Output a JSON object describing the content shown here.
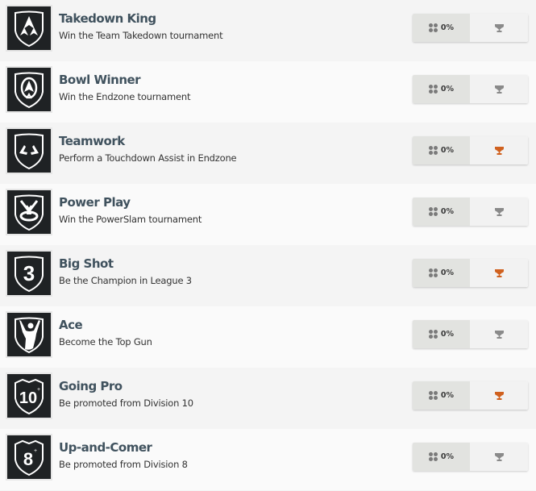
{
  "colors": {
    "trophy_earned": "#d0611f",
    "trophy_unearned": "#8a8a8a",
    "title": "#40525e"
  },
  "achievements": [
    {
      "title": "Takedown King",
      "description": "Win the Team Takedown tournament",
      "icon": "triple-arrow-shield-icon",
      "progress": "0%",
      "trophy": "unearned"
    },
    {
      "title": "Bowl Winner",
      "description": "Win the Endzone tournament",
      "icon": "bowl-arrow-shield-icon",
      "progress": "0%",
      "trophy": "unearned"
    },
    {
      "title": "Teamwork",
      "description": "Perform a Touchdown Assist in Endzone",
      "icon": "horns-shield-icon",
      "progress": "0%",
      "trophy": "earned"
    },
    {
      "title": "Power Play",
      "description": "Win the PowerSlam tournament",
      "icon": "powerslam-shield-icon",
      "progress": "0%",
      "trophy": "unearned"
    },
    {
      "title": "Big Shot",
      "description": "Be the Champion in League 3",
      "icon": "number-3-shield-icon",
      "progress": "0%",
      "trophy": "earned"
    },
    {
      "title": "Ace",
      "description": "Become the Top Gun",
      "icon": "victory-figure-shield-icon",
      "progress": "0%",
      "trophy": "unearned"
    },
    {
      "title": "Going Pro",
      "description": "Be promoted from Division 10",
      "icon": "division-10-shield-icon",
      "progress": "0%",
      "trophy": "earned"
    },
    {
      "title": "Up-and-Comer",
      "description": "Be promoted from Division 8",
      "icon": "division-8-shield-icon",
      "progress": "0%",
      "trophy": "unearned"
    }
  ],
  "badge_labels": {
    "big_shot": "3",
    "going_pro": "10",
    "up_and_comer": "8",
    "plus": "+"
  }
}
